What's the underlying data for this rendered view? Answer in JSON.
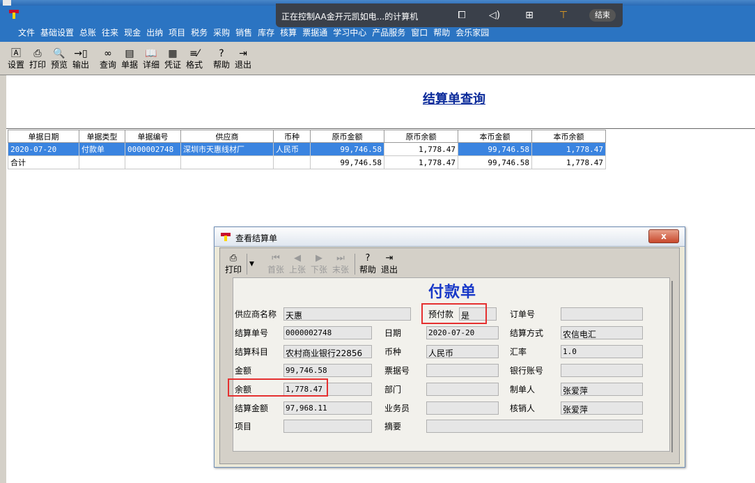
{
  "remote": {
    "title": "正在控制AA金开元凯如电...的计算机",
    "end_label": "结束"
  },
  "menu": [
    "文件",
    "基础设置",
    "总账",
    "往来",
    "现金",
    "出纳",
    "项目",
    "税务",
    "采购",
    "销售",
    "库存",
    "核算",
    "票据通",
    "学习中心",
    "产品服务",
    "窗口",
    "帮助",
    "会乐家园"
  ],
  "toolbar": [
    {
      "label": "设置",
      "icon": "settings-icon"
    },
    {
      "label": "打印",
      "icon": "print-icon"
    },
    {
      "label": "预览",
      "icon": "preview-icon"
    },
    {
      "label": "输出",
      "icon": "export-icon"
    },
    {
      "label": "查询",
      "icon": "binoculars-icon"
    },
    {
      "label": "单据",
      "icon": "document-icon"
    },
    {
      "label": "详细",
      "icon": "book-icon"
    },
    {
      "label": "凭证",
      "icon": "voucher-icon"
    },
    {
      "label": "格式",
      "icon": "format-icon"
    },
    {
      "label": "帮助",
      "icon": "help-icon"
    },
    {
      "label": "退出",
      "icon": "exit-icon"
    }
  ],
  "report": {
    "title": "结算单查询",
    "columns": [
      "单据日期",
      "单据类型",
      "单据编号",
      "供应商",
      "币种",
      "原币金额",
      "原币余额",
      "本币金额",
      "本币余额"
    ],
    "rows": [
      [
        "2020-07-20",
        "付款单",
        "0000002748",
        "深圳市天惠线材厂",
        "人民币",
        "99,746.58",
        "1,778.47",
        "99,746.58",
        "1,778.47"
      ],
      [
        "合计",
        "",
        "",
        "",
        "",
        "99,746.58",
        "1,778.47",
        "99,746.58",
        "1,778.47"
      ]
    ]
  },
  "dialog": {
    "title": "查看结算单",
    "close_label": "x",
    "buttons": {
      "print": "打印",
      "first": "首张",
      "prev": "上张",
      "next": "下张",
      "last": "末张",
      "help": "帮助",
      "exit": "退出"
    },
    "voucher_title": "付款单",
    "fields": {
      "supplier_label": "供应商名称",
      "supplier": "天惠",
      "prepay_label": "预付款",
      "prepay": "是",
      "order_label": "订单号",
      "order": "",
      "settle_no_label": "结算单号",
      "settle_no": "0000002748",
      "date_label": "日期",
      "date": "2020-07-20",
      "settle_method_label": "结算方式",
      "settle_method": "农信电汇",
      "account_label": "结算科目",
      "account": "农村商业银行22856",
      "currency_label": "币种",
      "currency": "人民币",
      "rate_label": "汇率",
      "rate": "1.0",
      "amount_label": "金额",
      "amount": "99,746.58",
      "bill_no_label": "票据号",
      "bill_no": "",
      "bank_label": "银行账号",
      "bank": "",
      "balance_label": "余额",
      "balance": "1,778.47",
      "dept_label": "部门",
      "dept": "",
      "maker_label": "制单人",
      "maker": "张爱萍",
      "settle_amount_label": "结算金额",
      "settle_amount": "97,968.11",
      "salesman_label": "业务员",
      "salesman": "",
      "writeoff_label": "核销人",
      "writeoff": "张爱萍",
      "project_label": "项目",
      "project": "",
      "summary_label": "摘要",
      "summary": ""
    }
  }
}
